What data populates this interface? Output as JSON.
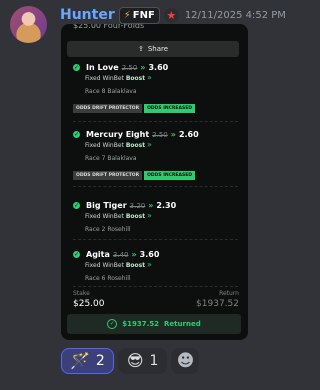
{
  "message": {
    "username": "Hunter",
    "tag_label": "FNF",
    "timestamp": "12/11/2025 4:52 PM"
  },
  "bet_card": {
    "top_cut_text": "$25.00 Four-Folds",
    "share_label": "Share",
    "legs": [
      {
        "selection": "In Love",
        "old_odds": "2.50",
        "new_odds": "3.60",
        "bet_type": "Fixed WinBet",
        "boost_label": "Boost",
        "race": "Race 8 Balaklava",
        "badges": [
          "ODDS DRIFT PROTECTOR",
          "ODDS INCREASED"
        ]
      },
      {
        "selection": "Mercury Eight",
        "old_odds": "2.50",
        "new_odds": "2.60",
        "bet_type": "Fixed WinBet",
        "boost_label": "Boost",
        "race": "Race 7 Balaklava",
        "badges": [
          "ODDS DRIFT PROTECTOR",
          "ODDS INCREASED"
        ]
      },
      {
        "selection": "Big Tiger",
        "old_odds": "3.20",
        "new_odds": "2.30",
        "bet_type": "Fixed WinBet",
        "boost_label": "Boost",
        "race": "Race 2 Rosehill",
        "badges": []
      },
      {
        "selection": "Agita",
        "old_odds": "3.40",
        "new_odds": "3.60",
        "bet_type": "Fixed WinBet",
        "boost_label": "Boost",
        "race": "Race 6 Rosehill",
        "badges": []
      }
    ],
    "stake_label": "Stake",
    "stake_value": "$25.00",
    "return_label": "Return",
    "return_value": "$1937.52",
    "returned_amount": "$1937.52",
    "returned_label": "Returned"
  },
  "reactions": [
    {
      "emoji": "🪄",
      "count": "2",
      "active": true
    },
    {
      "emoji": "😎",
      "count": "1",
      "active": false
    }
  ],
  "colors": {
    "accent_green": "#2ecc71",
    "username": "#6aa7ff",
    "background": "#313338",
    "card": "#0d0f0e"
  },
  "icons": [
    "lightning-icon",
    "star-icon",
    "share-icon",
    "check-icon",
    "add-reaction-icon"
  ]
}
